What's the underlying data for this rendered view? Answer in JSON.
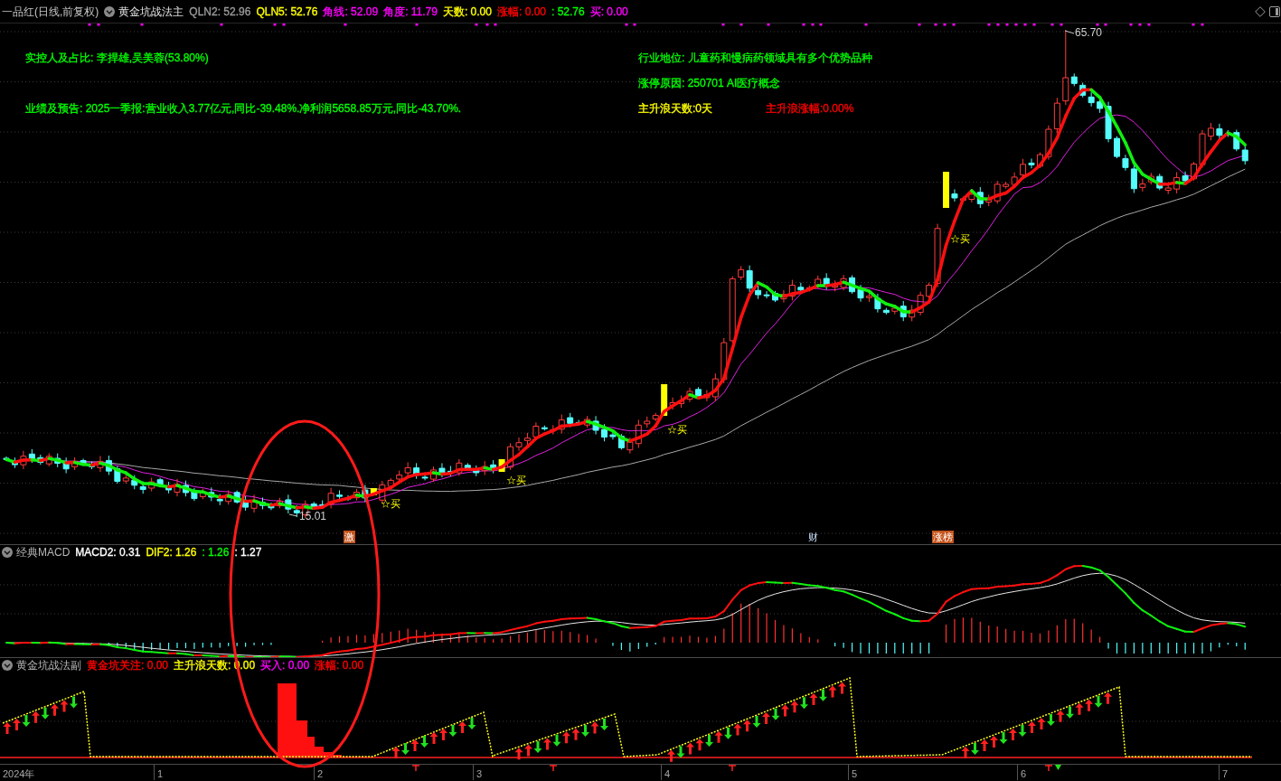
{
  "header": {
    "title": "一品红(日线,前复权)",
    "indicator": "黄金坑战法主",
    "readings": [
      {
        "text": "QLN2: 52.96",
        "color": "#9a9a9a"
      },
      {
        "text": "QLN5: 52.76",
        "color": "#ffff00"
      },
      {
        "text": "角线: 52.09",
        "color": "#ff00ff"
      },
      {
        "text": "角度: 11.79",
        "color": "#ff00ff"
      },
      {
        "text": "天数: 0.00",
        "color": "#ffff00"
      },
      {
        "text": "涨幅: 0.00",
        "color": "#ff0000"
      },
      {
        "text": ": 52.76",
        "color": "#00ff00"
      },
      {
        "text": "买: 0.00",
        "color": "#ff00ff"
      }
    ]
  },
  "main_chart": {
    "notes": [
      {
        "text": "实控人及占比: 李捍雄,吴美蓉(53.80%)",
        "color": "#00ff00"
      },
      {
        "text": "行业地位: 儿童药和慢病药领域具有多个优势品种",
        "color": "#00ff00"
      },
      {
        "text": "涨停原因: 250701 AI医疗概念",
        "color": "#00ff00"
      },
      {
        "text": "业绩及预告: 2025一季报:营业收入3.77亿元,同比-39.48%.净利润5658.85万元,同比-43.70%.",
        "color": "#00ff00"
      },
      {
        "text": "主升浪天数:0天",
        "color": "#ffff00"
      },
      {
        "text": "主升浪涨幅:0.00%",
        "color": "#ff0000"
      }
    ],
    "high_label": "65.70",
    "low_label": "15.01",
    "buy_labels": [
      "☆买",
      "☆买",
      "☆买",
      "☆买"
    ],
    "event_tags": [
      {
        "text": "激",
        "kind": "boxed"
      },
      {
        "text": "财",
        "kind": "plain"
      },
      {
        "text": "涨榜",
        "kind": "boxed"
      }
    ]
  },
  "macd_panel": {
    "title": "经典MACD",
    "readings": [
      {
        "text": "MACD2: 0.31",
        "color": "#ffffff"
      },
      {
        "text": "DIF2: 1.26",
        "color": "#ffff00"
      },
      {
        "text": ": 1.26",
        "color": "#00ff00"
      },
      {
        "text": ": 1.27",
        "color": "#ffffff"
      }
    ]
  },
  "sub_panel": {
    "title": "黄金坑战法副",
    "readings": [
      {
        "text": "黄金坑关注: 0.00",
        "color": "#ff0000"
      },
      {
        "text": "主升浪天数: 0.00",
        "color": "#ffff00"
      },
      {
        "text": "买入: 0.00",
        "color": "#ff00ff"
      },
      {
        "text": "涨幅: 0.00",
        "color": "#ff0000"
      }
    ]
  },
  "x_axis": {
    "labels": [
      "2024年",
      "1",
      "2",
      "3",
      "4",
      "5",
      "6",
      "7"
    ]
  }
}
